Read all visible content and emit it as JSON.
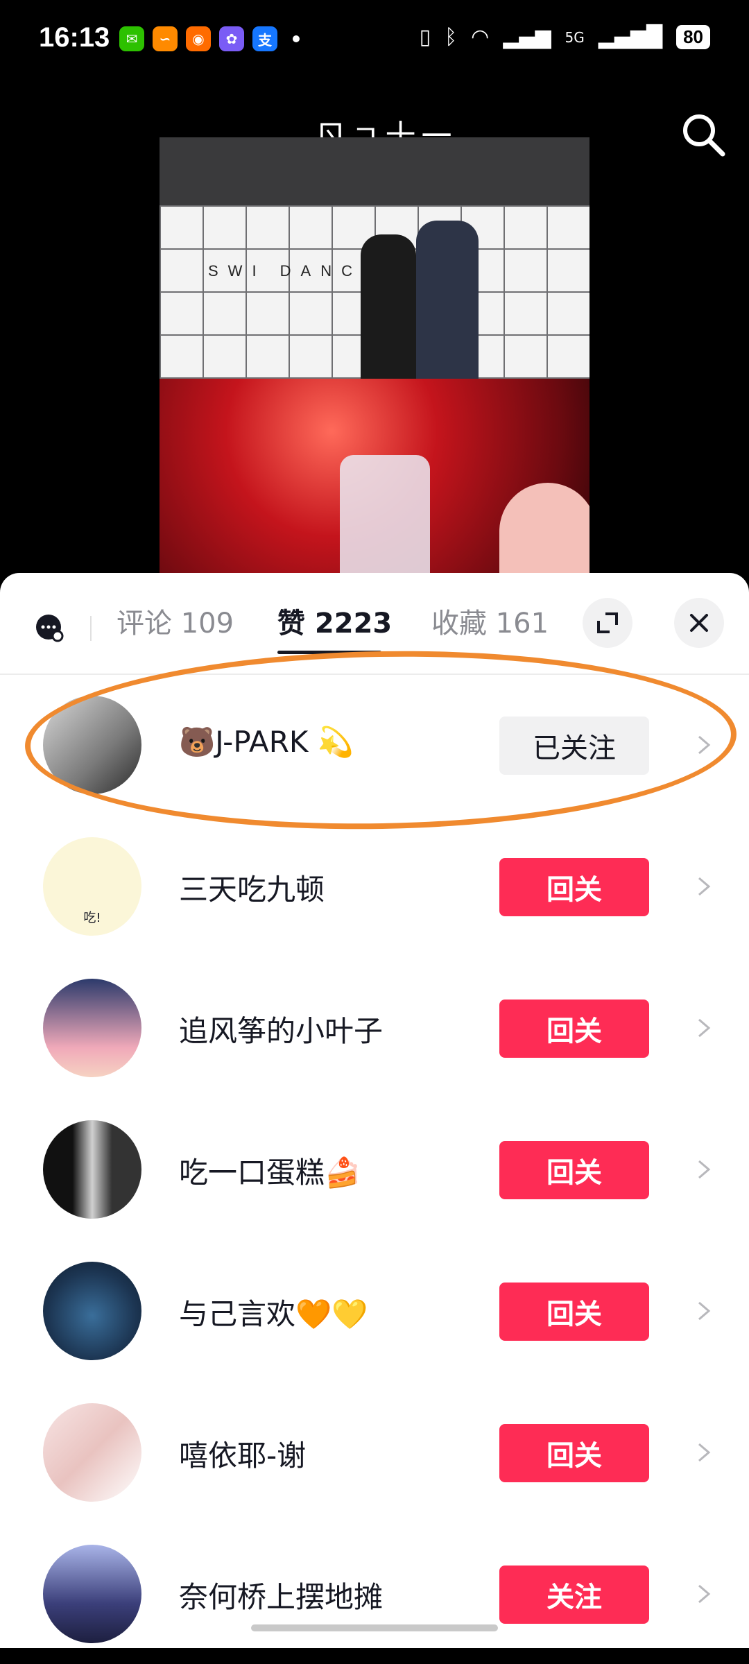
{
  "status_bar": {
    "time": "16:13",
    "battery": "80",
    "network": "5G",
    "apps": [
      {
        "name": "wechat-icon",
        "color": "#2dc100",
        "glyph": "✉"
      },
      {
        "name": "taobao-app-icon",
        "color": "#ff8a00",
        "glyph": "∽"
      },
      {
        "name": "weibo-icon",
        "color": "#ff6b00",
        "glyph": "◉"
      },
      {
        "name": "rabbit-app-icon",
        "color": "#7a5cf5",
        "glyph": "✿"
      },
      {
        "name": "alipay-icon",
        "color": "#1677ff",
        "glyph": "支"
      }
    ]
  },
  "video": {
    "title": "ㄖㄱ十一",
    "sign_text": "SWI DANC  HOOL"
  },
  "sheet": {
    "tabs": [
      {
        "label": "评论 109",
        "active": false
      },
      {
        "label": "赞 2223",
        "active": true
      },
      {
        "label": "收藏 161",
        "active": false
      }
    ],
    "users": [
      {
        "name": "🐻J-PARK 💫",
        "button": "已关注",
        "style": "gray",
        "avatar_color": "#9b9b9b",
        "highlighted": true
      },
      {
        "name": "三天吃九顿",
        "button": "回关",
        "style": "red",
        "avatar_color": "#f5f0d0",
        "avatar_text": "吃!"
      },
      {
        "name": "追风筝的小叶子",
        "button": "回关",
        "style": "red",
        "avatar_color": "#c8b7e6"
      },
      {
        "name": "吃一口蛋糕🍰",
        "button": "回关",
        "style": "red",
        "avatar_color": "#2b2b2b"
      },
      {
        "name": "与己言欢🧡💛",
        "button": "回关",
        "style": "red",
        "avatar_color": "#1e3a5c"
      },
      {
        "name": "嘻依耶-谢",
        "button": "回关",
        "style": "red",
        "avatar_color": "#f3d6d6"
      },
      {
        "name": "奈何桥上摆地摊",
        "button": "关注",
        "style": "red",
        "avatar_color": "#3b3f7a"
      }
    ]
  },
  "colors": {
    "accent_red": "#fe2c55",
    "highlight_orange": "#f08a2f"
  }
}
